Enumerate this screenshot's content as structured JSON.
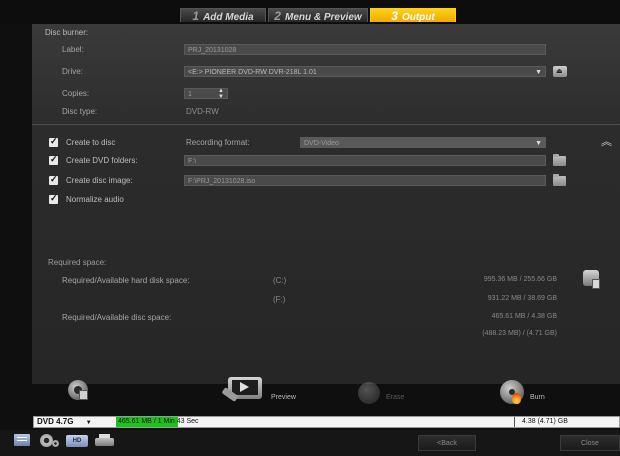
{
  "tabs": [
    {
      "num": "1",
      "label": "Add Media"
    },
    {
      "num": "2",
      "label": "Menu & Preview"
    },
    {
      "num": "3",
      "label": "Output"
    }
  ],
  "disc_burner": {
    "title": "Disc burner:",
    "label_label": "Label:",
    "label_value": "PRJ_20131028",
    "drive_label": "Drive:",
    "drive_value": "<E:> PIONEER DVD-RW  DVR-218L 1.01",
    "copies_label": "Copies:",
    "copies_value": "1",
    "disc_type_label": "Disc type:",
    "disc_type_value": "DVD-RW"
  },
  "options": {
    "create_to_disc": "Create to disc",
    "create_dvd_folders": "Create DVD folders:",
    "create_disc_image": "Create disc image:",
    "normalize_audio": "Normalize audio",
    "recording_format_label": "Recording format:",
    "recording_format_value": "DVD-Video",
    "folders_path": "F:\\",
    "image_path": "F:\\PRJ_20131028.iso"
  },
  "space": {
    "title": "Required space:",
    "hdd_label": "Required/Available hard disk space:",
    "disc_label": "Required/Available disc space:",
    "drive_c": "(C:)",
    "drive_f": "(F:)",
    "c_value": "995.36 MB / 255.66 GB",
    "f_value": "931.22 MB / 38.69 GB",
    "disc_value": "465.61 MB / 4.38 GB",
    "disc_value2": "(488.23 MB) / (4.71 GB)"
  },
  "actions": {
    "preview": "Preview",
    "erase": "Erase",
    "burn": "Burn"
  },
  "status_bar": {
    "disc_size": "DVD 4.7G",
    "used": "465.61 MB",
    "duration": "/ 1 Min 43 Sec",
    "capacity": "4.38 (4.71) GB",
    "fill_fraction": 0.106
  },
  "bottom": {
    "back": "<Back",
    "close": "Close",
    "hd_badge": "HD"
  },
  "colors": {
    "accent": "#f5b800",
    "progress": "#19c419"
  }
}
